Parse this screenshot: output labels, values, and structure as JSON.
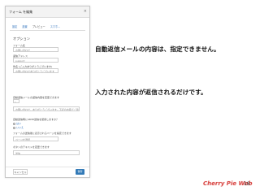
{
  "modal": {
    "title": "フォーム を編集",
    "close": "×",
    "tabs": [
      "設定",
      "設置",
      "プレビュー",
      "スマホ..."
    ],
    "section_title": "オプション",
    "fields": [
      {
        "label": "フォーム名",
        "value": "お問い合わせ"
      },
      {
        "label": "返信アドレス",
        "value": "support"
      },
      {
        "label": "件名 (ご入力ありがとうございます)",
        "value": "お問い合わせありがとうございます"
      },
      {
        "label": "自動返信メールの返信内容を変更できます",
        "value": "お問い合わせ、ありがとうございます。下記の内容でご連絡..."
      }
    ],
    "small_field_value": "1",
    "question_label": "自動送信時にSMTP送信を使用しますか？",
    "radios": [
      "はい",
      "いいえ"
    ],
    "field_b_label": "フォームの送信後に表示されるページを指定できます",
    "field_b_value": "ページを選択",
    "field_c_label": "ボタンのテキストを変更できます",
    "field_c_value": "送信",
    "cancel_label": "キャンセル",
    "save_label": "保存"
  },
  "callouts": {
    "line1": "自動返信メールの内容は、指定できません。",
    "line2": "入力された内容が返信されるだけです。"
  },
  "footer": {
    "logo": "Cherry Pie Web",
    "page_number": "18"
  }
}
